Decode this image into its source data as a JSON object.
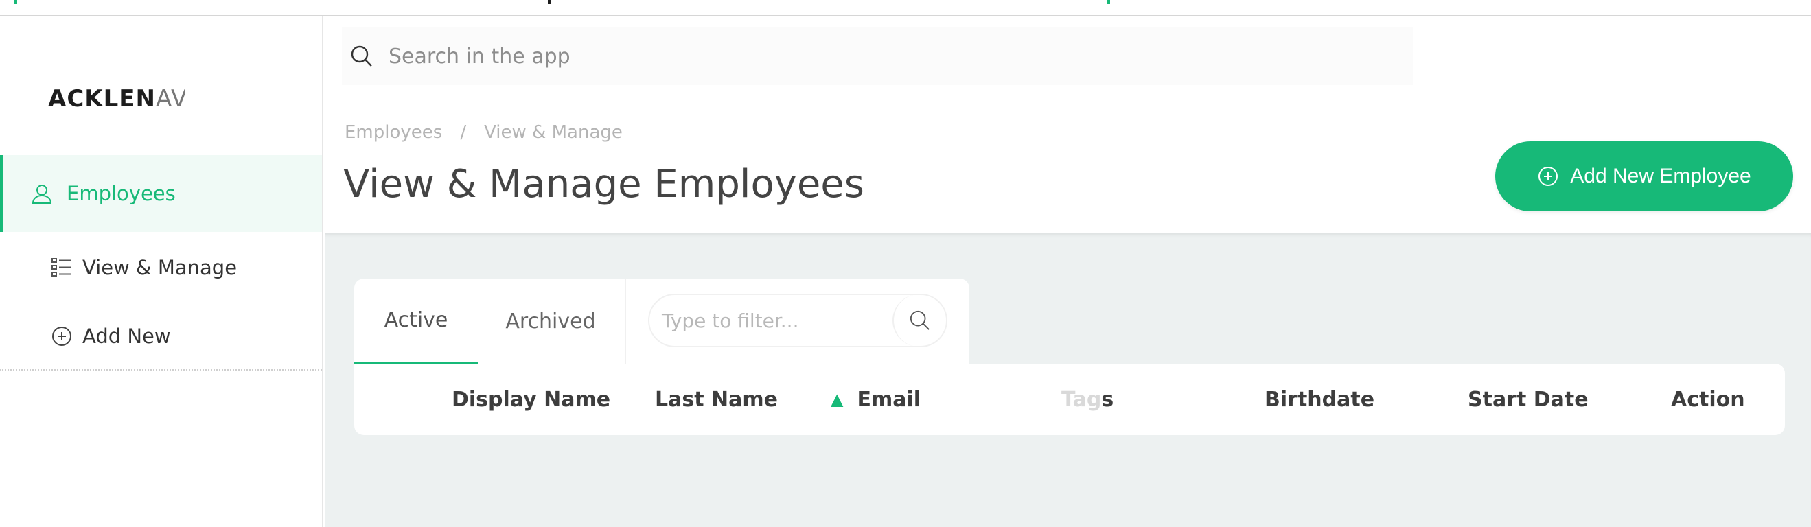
{
  "app": {
    "logo_main": "ACKLEN",
    "logo_fade": "AV",
    "accent_color": "#17b978"
  },
  "search": {
    "placeholder": "Search in the app",
    "icon": "search-icon"
  },
  "sidebar": {
    "items": [
      {
        "label": "Employees",
        "icon": "user-icon",
        "active": true
      },
      {
        "label": "View & Manage",
        "icon": "list-icon",
        "active": false
      },
      {
        "label": "Add New",
        "icon": "plus-circle-icon",
        "active": false
      }
    ]
  },
  "breadcrumb": [
    "Employees",
    "/",
    "View & Manage"
  ],
  "page": {
    "title": "View & Manage Employees",
    "add_button_label": "Add New Employee"
  },
  "tabs": [
    {
      "label": "Active",
      "selected": true
    },
    {
      "label": "Archived",
      "selected": false
    }
  ],
  "filter": {
    "placeholder": "Type to filter..."
  },
  "table": {
    "columns": [
      {
        "label": "Display Name"
      },
      {
        "label": "Last Name"
      },
      {
        "label": "Email",
        "sorted": "ascending"
      },
      {
        "label_fade": "Tag",
        "label_rest": "s"
      },
      {
        "label": "Birthdate"
      },
      {
        "label": "Start Date"
      },
      {
        "label": "Action"
      }
    ]
  }
}
